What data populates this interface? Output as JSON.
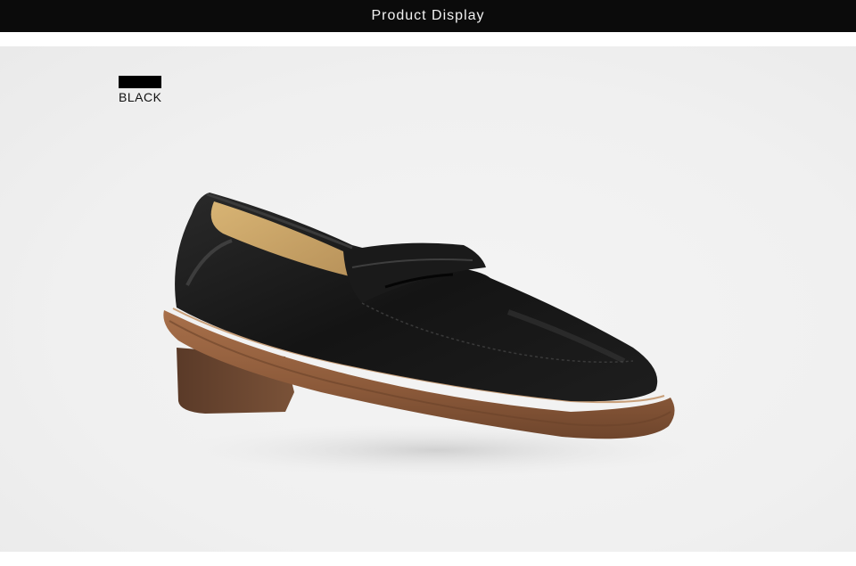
{
  "header": {
    "title": "Product Display"
  },
  "color_option": {
    "label": "BLACK",
    "swatch_color": "#000000"
  },
  "product": {
    "image_icon": "black-penny-loafer-shoe"
  },
  "colors": {
    "header_bg": "#0b0b0b",
    "header_text": "#f2f2f2",
    "stage_bg": "#f0f0f0"
  }
}
